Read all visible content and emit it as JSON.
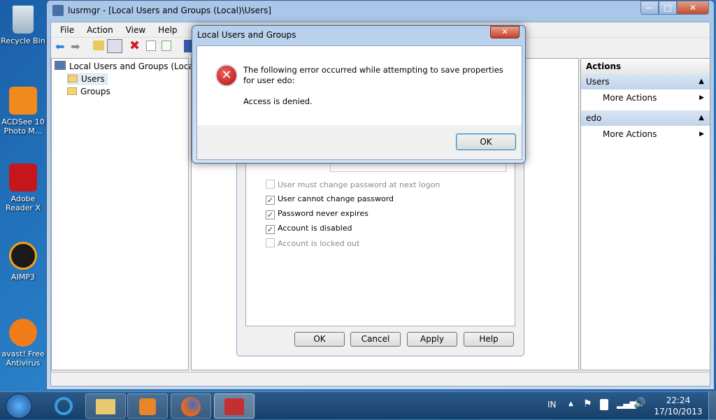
{
  "desktop": {
    "icons": [
      {
        "label": "Recycle Bin",
        "icon": "recycle-bin-icon"
      },
      {
        "label": "ACDSee 10 Photo M...",
        "icon": "acdsee-icon"
      },
      {
        "label": "Adobe Reader X",
        "icon": "adobe-reader-icon"
      },
      {
        "label": "AIMP3",
        "icon": "aimp-icon"
      },
      {
        "label": "avast! Free Antivirus",
        "icon": "avast-icon"
      }
    ]
  },
  "window": {
    "title": "lusrmgr - [Local Users and Groups (Local)\\Users]",
    "controls": {
      "minimize": "—",
      "maximize": "□",
      "close": "✕"
    }
  },
  "menu": [
    "File",
    "Action",
    "View",
    "Help"
  ],
  "tree": {
    "root": "Local Users and Groups (Local)",
    "items": [
      "Users",
      "Groups"
    ],
    "selected": "Users"
  },
  "actions": {
    "header": "Actions",
    "sections": [
      {
        "title": "Users",
        "item": "More Actions"
      },
      {
        "title": "edo",
        "item": "More Actions"
      }
    ]
  },
  "properties": {
    "checkboxes": [
      {
        "label": "User must change password at next logon",
        "checked": false,
        "enabled": false
      },
      {
        "label": "User cannot change password",
        "checked": true,
        "enabled": true
      },
      {
        "label": "Password never expires",
        "checked": true,
        "enabled": true
      },
      {
        "label": "Account is disabled",
        "checked": true,
        "enabled": true
      },
      {
        "label": "Account is locked out",
        "checked": false,
        "enabled": false
      }
    ],
    "buttons": [
      "OK",
      "Cancel",
      "Apply",
      "Help"
    ]
  },
  "error": {
    "title": "Local Users and Groups",
    "message": "The following error occurred while attempting to save properties for user edo:",
    "detail": "Access is denied.",
    "ok": "OK",
    "close": "✕",
    "icon": "error-icon"
  },
  "taskbar": {
    "lang": "IN",
    "time": "22:24",
    "date": "17/10/2013",
    "apps": [
      "internet-explorer-icon",
      "windows-explorer-icon",
      "media-player-icon",
      "firefox-icon",
      "computer-management-icon"
    ]
  },
  "colors": {
    "accent": "#1c64ad",
    "error": "#c8202a"
  }
}
